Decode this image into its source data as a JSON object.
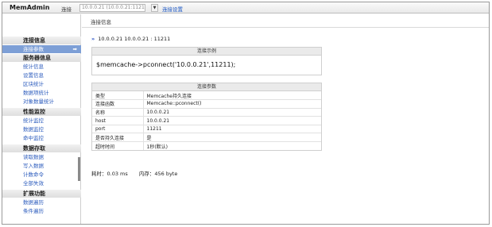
{
  "app": {
    "title": "MemAdmin"
  },
  "topbar": {
    "connect_label": "连接",
    "connection_value": "10.0.0.21 (10.0.0.21:11211)",
    "dropdown_icon": "▼",
    "settings_link": "连接设置"
  },
  "sidebar": {
    "sections": [
      {
        "title": "连接信息",
        "items": [
          {
            "label": "连接参数",
            "active": true
          }
        ]
      },
      {
        "title": "服务器信息",
        "items": [
          {
            "label": "统计信息"
          },
          {
            "label": "设置信息"
          },
          {
            "label": "区块统计"
          },
          {
            "label": "数据项统计"
          },
          {
            "label": "对象数量统计"
          }
        ]
      },
      {
        "title": "性能监控",
        "items": [
          {
            "label": "统计监控"
          },
          {
            "label": "数据监控"
          },
          {
            "label": "命中监控"
          }
        ]
      },
      {
        "title": "数据存取",
        "items": [
          {
            "label": "读取数据"
          },
          {
            "label": "写入数据"
          },
          {
            "label": "计数命令"
          },
          {
            "label": "全部失效"
          }
        ]
      },
      {
        "title": "扩展功能",
        "items": [
          {
            "label": "数据遍历"
          },
          {
            "label": "条件遍历"
          }
        ]
      }
    ],
    "active_arrow": "➡"
  },
  "main": {
    "header": "连接信息",
    "address_chevron": "»",
    "address": "10.0.0.21 10.0.0.21 : 11211",
    "example": {
      "title": "连接示例",
      "code": "$memcache->pconnect('10.0.0.21',11211);"
    },
    "params": {
      "title": "连接参数",
      "rows": [
        {
          "key": "类型",
          "value": "Memcache持久连接"
        },
        {
          "key": "连接函数",
          "value": "Memcache::pconnect()"
        },
        {
          "key": "名称",
          "value": "10.0.0.21"
        },
        {
          "key": "host",
          "value": "10.0.0.21"
        },
        {
          "key": "port",
          "value": "11211"
        },
        {
          "key": "是否持久连接",
          "value": "是"
        },
        {
          "key": "超时时间",
          "value": "1秒(默认)"
        }
      ]
    },
    "timing": {
      "elapsed": "耗时：0.03 ms",
      "memory": "内存：456 byte"
    }
  }
}
